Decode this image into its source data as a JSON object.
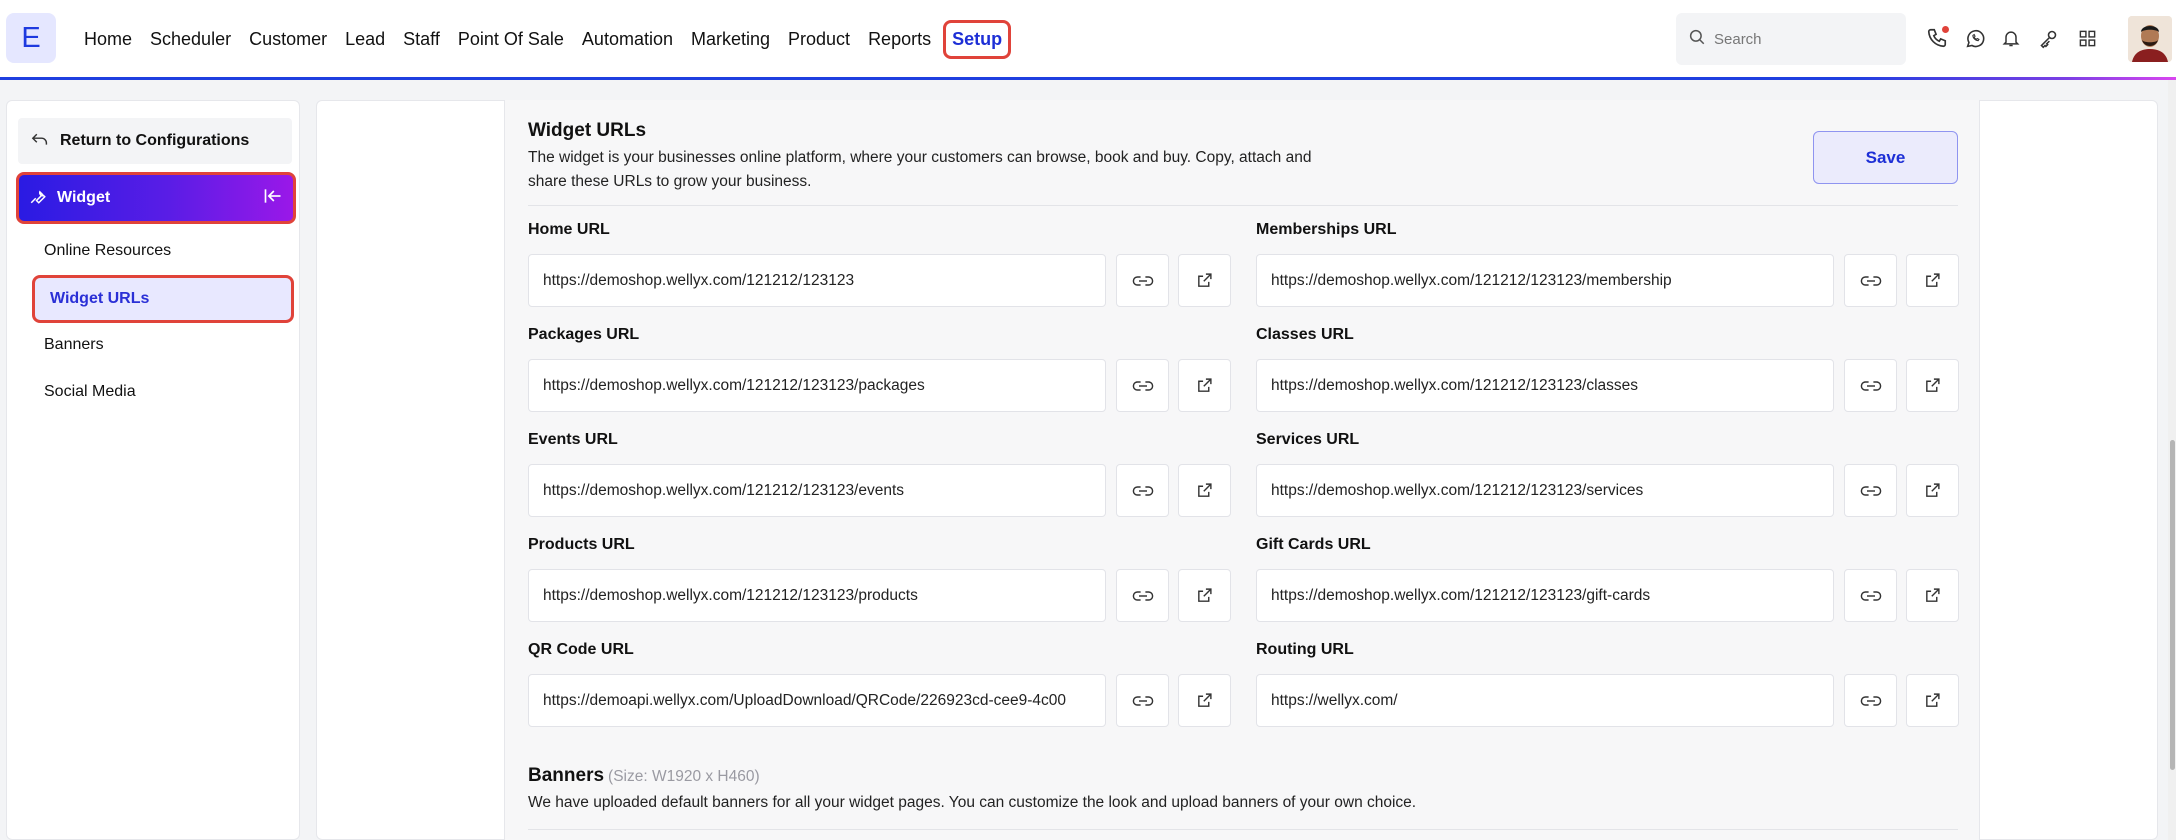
{
  "app": {
    "logo_letter": "E"
  },
  "nav": {
    "items": [
      "Home",
      "Scheduler",
      "Customer",
      "Lead",
      "Staff",
      "Point Of Sale",
      "Automation",
      "Marketing",
      "Product",
      "Reports"
    ],
    "active": "Setup"
  },
  "search": {
    "placeholder": "Search"
  },
  "sidebar": {
    "return_label": "Return to Configurations",
    "section_label": "Widget",
    "items": [
      "Online Resources",
      "Widget URLs",
      "Banners",
      "Social Media"
    ],
    "active_item": "Widget URLs"
  },
  "widget_urls": {
    "title": "Widget URLs",
    "description_line1": "The widget is your businesses online platform, where your customers can browse, book and buy. Copy, attach and",
    "description_line2": "share these URLs to grow your business.",
    "save_label": "Save",
    "fields": [
      {
        "label": "Home URL",
        "value": "https://demoshop.wellyx.com/121212/123123"
      },
      {
        "label": "Memberships URL",
        "value": "https://demoshop.wellyx.com/121212/123123/membership"
      },
      {
        "label": "Packages URL",
        "value": "https://demoshop.wellyx.com/121212/123123/packages"
      },
      {
        "label": "Classes URL",
        "value": "https://demoshop.wellyx.com/121212/123123/classes"
      },
      {
        "label": "Events URL",
        "value": "https://demoshop.wellyx.com/121212/123123/events"
      },
      {
        "label": "Services URL",
        "value": "https://demoshop.wellyx.com/121212/123123/services"
      },
      {
        "label": "Products URL",
        "value": "https://demoshop.wellyx.com/121212/123123/products"
      },
      {
        "label": "Gift Cards URL",
        "value": "https://demoshop.wellyx.com/121212/123123/gift-cards"
      },
      {
        "label": "QR Code URL",
        "value": "https://demoapi.wellyx.com/UploadDownload/QRCode/226923cd-cee9-4c00"
      },
      {
        "label": "Routing URL",
        "value": "https://wellyx.com/"
      }
    ]
  },
  "banners": {
    "title": "Banners",
    "size_note": "(Size: W1920 x H460)",
    "description": "We have uploaded default banners for all your widget pages. You can customize the look and upload banners of your own choice."
  },
  "colors": {
    "accent": "#1d2fd6",
    "highlight": "#e0433a"
  }
}
